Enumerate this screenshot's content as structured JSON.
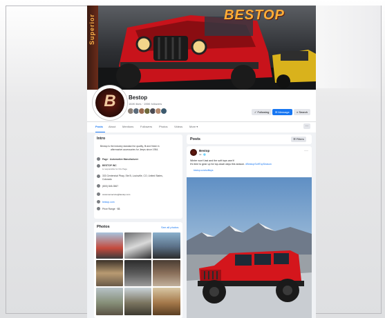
{
  "cover": {
    "brand_text": "BESTOP",
    "side_text": "Superior",
    "accent": "#ffae38"
  },
  "page": {
    "name": "Bestop",
    "stats": "184K likes · 196K followers",
    "avatar_letter": "B"
  },
  "header_buttons": {
    "following": "Following",
    "message": "Message",
    "search": "Search"
  },
  "nav": {
    "tabs": [
      "Posts",
      "About",
      "Mentions",
      "Followers",
      "Photos",
      "Videos",
      "More ▾"
    ],
    "more_icon": "···"
  },
  "intro": {
    "title": "Intro",
    "description_line1": "Bestop is the industry standard for quality, fit and finish in",
    "description_line2": "aftermarket accessories for Jeeps since 1954.",
    "category": "Page · Automotive Manufacturer",
    "company": "BESTOP INC",
    "company_sub": "is responsible for this Page",
    "address_line1": "333 Centennial Pkwy, Ste B, Louisville, CO, United States,",
    "address_line2": "Colorado",
    "phone": "(800) 845-3567",
    "email": "customerservice@bestop.com",
    "website": "bestop.com",
    "price_range": "Price Range · $$"
  },
  "photos": {
    "title": "Photos",
    "see_all": "See all photos"
  },
  "posts": {
    "title": "Posts",
    "filters": "Filters",
    "author": "Bestop",
    "time": "3d · 🌐",
    "options_icon": "···",
    "text_line1": "Winter won't last and the soft tops won't!",
    "text_line2": "It's time to gear up for top-down days this season.",
    "hashtag": "#BestopSoftTopSeason",
    "link_text": "bestop.com/softtops"
  }
}
